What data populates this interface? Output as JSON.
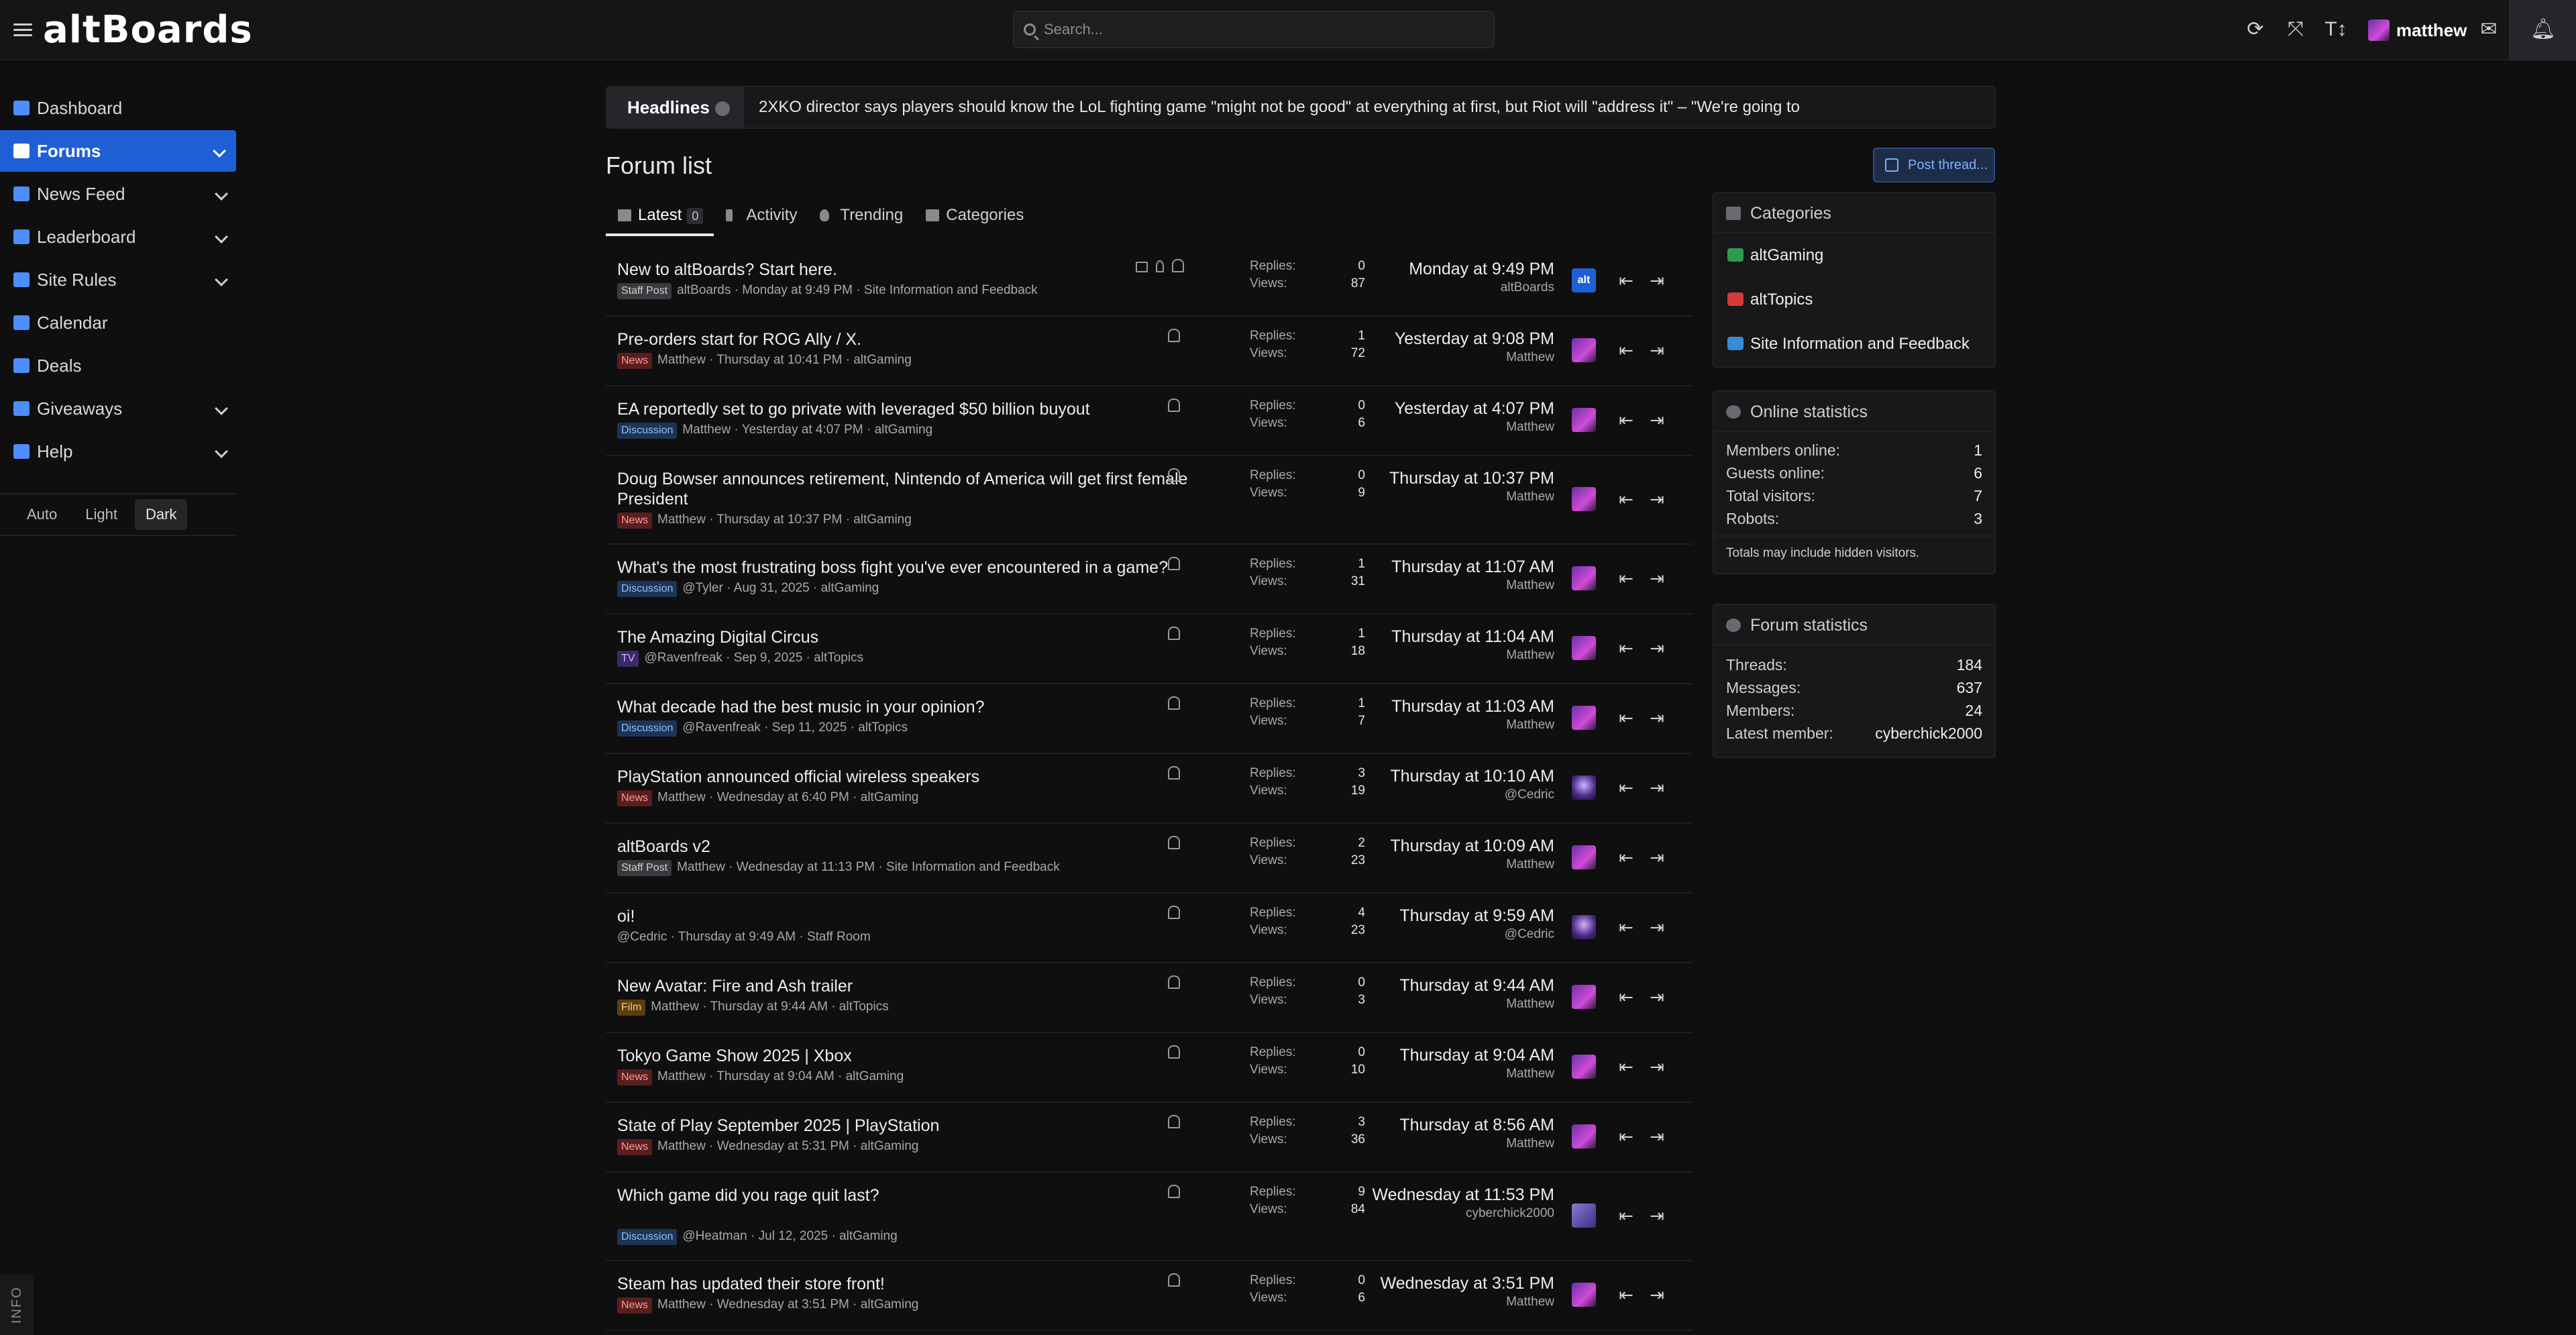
{
  "app": {
    "logo": "altBoards"
  },
  "search": {
    "placeholder": "Search..."
  },
  "user": {
    "name": "matthew"
  },
  "sidebar": {
    "items": [
      {
        "label": "Dashboard",
        "icon": "dashboard-icon",
        "color": "#4d8dff",
        "expandable": false,
        "active": false
      },
      {
        "label": "Forums",
        "icon": "forums-icon",
        "color": "#ffffff",
        "expandable": true,
        "active": true
      },
      {
        "label": "News Feed",
        "icon": "news-icon",
        "color": "#4d8dff",
        "expandable": true,
        "active": false
      },
      {
        "label": "Leaderboard",
        "icon": "trophy-icon",
        "color": "#4d8dff",
        "expandable": true,
        "active": false
      },
      {
        "label": "Site Rules",
        "icon": "gavel-icon",
        "color": "#4d8dff",
        "expandable": true,
        "active": false
      },
      {
        "label": "Calendar",
        "icon": "calendar-icon",
        "color": "#4d8dff",
        "expandable": false,
        "active": false
      },
      {
        "label": "Deals",
        "icon": "deals-icon",
        "color": "#4d8dff",
        "expandable": false,
        "active": false
      },
      {
        "label": "Giveaways",
        "icon": "gift-icon",
        "color": "#4d8dff",
        "expandable": true,
        "active": false
      },
      {
        "label": "Help",
        "icon": "help-icon",
        "color": "#4d8dff",
        "expandable": true,
        "active": false
      }
    ],
    "theme": {
      "auto": "Auto",
      "light": "Light",
      "dark": "Dark",
      "selected": "Dark"
    },
    "info_tab": "INFO"
  },
  "headlines": {
    "label": "Headlines",
    "text": "2XKO director says players should know the LoL fighting game \"might not be good\" at everything at first, but Riot will \"address it\" – \"We're going to"
  },
  "main": {
    "title": "Forum list",
    "post_button": "Post thread...",
    "tabs": [
      {
        "label": "Latest",
        "count": "0"
      },
      {
        "label": "Activity"
      },
      {
        "label": "Trending"
      },
      {
        "label": "Categories"
      }
    ],
    "replies_label": "Replies:",
    "views_label": "Views:",
    "threads": [
      {
        "title": "New to altBoards? Start here.",
        "badge": "Staff Post",
        "badge_class": "b-staff",
        "author": "altBoards",
        "date": "Monday at 9:49 PM",
        "forum": "Site Information and Feedback",
        "replies": "0",
        "views": "87",
        "last_time": "Monday at 9:49 PM",
        "last_user": "altBoards",
        "locked": true,
        "avatar": "alt",
        "avatar_text": "alt"
      },
      {
        "title": "Pre-orders start for ROG Ally / X.",
        "badge": "News",
        "badge_class": "b-news",
        "author": "Matthew",
        "date": "Thursday at 10:41 PM",
        "forum": "altGaming",
        "replies": "1",
        "views": "72",
        "last_time": "Yesterday at 9:08 PM",
        "last_user": "Matthew",
        "avatar": "mat"
      },
      {
        "title": "EA reportedly set to go private with leveraged $50 billion buyout",
        "badge": "Discussion",
        "badge_class": "b-disc",
        "author": "Matthew",
        "date": "Yesterday at 4:07 PM",
        "forum": "altGaming",
        "replies": "0",
        "views": "6",
        "last_time": "Yesterday at 4:07 PM",
        "last_user": "Matthew",
        "avatar": "mat"
      },
      {
        "title": "Doug Bowser announces retirement, Nintendo of America will get first female President",
        "badge": "News",
        "badge_class": "b-news",
        "author": "Matthew",
        "date": "Thursday at 10:37 PM",
        "forum": "altGaming",
        "replies": "0",
        "views": "9",
        "last_time": "Thursday at 10:37 PM",
        "last_user": "Matthew",
        "avatar": "mat",
        "tall": true
      },
      {
        "title": "What's the most frustrating boss fight you've ever encountered in a game?",
        "badge": "Discussion",
        "badge_class": "b-disc",
        "author": "@Tyler",
        "date": "Aug 31, 2025",
        "forum": "altGaming",
        "replies": "1",
        "views": "31",
        "last_time": "Thursday at 11:07 AM",
        "last_user": "Matthew",
        "avatar": "mat"
      },
      {
        "title": "The Amazing Digital Circus",
        "badge": "TV",
        "badge_class": "b-tv",
        "author": "@Ravenfreak",
        "date": "Sep 9, 2025",
        "forum": "altTopics",
        "replies": "1",
        "views": "18",
        "last_time": "Thursday at 11:04 AM",
        "last_user": "Matthew",
        "avatar": "mat"
      },
      {
        "title": "What decade had the best music in your opinion?",
        "badge": "Discussion",
        "badge_class": "b-disc",
        "author": "@Ravenfreak",
        "date": "Sep 11, 2025",
        "forum": "altTopics",
        "replies": "1",
        "views": "7",
        "last_time": "Thursday at 11:03 AM",
        "last_user": "Matthew",
        "avatar": "mat"
      },
      {
        "title": "PlayStation announced official wireless speakers",
        "badge": "News",
        "badge_class": "b-news",
        "author": "Matthew",
        "date": "Wednesday at 6:40 PM",
        "forum": "altGaming",
        "replies": "3",
        "views": "19",
        "last_time": "Thursday at 10:10 AM",
        "last_user": "@Cedric",
        "avatar": "ced"
      },
      {
        "title": "altBoards v2",
        "badge": "Staff Post",
        "badge_class": "b-staff",
        "author": "Matthew",
        "date": "Wednesday at 11:13 PM",
        "forum": "Site Information and Feedback",
        "replies": "2",
        "views": "23",
        "last_time": "Thursday at 10:09 AM",
        "last_user": "Matthew",
        "avatar": "mat"
      },
      {
        "title": "oi!",
        "badge": "",
        "badge_class": "",
        "author": "@Cedric",
        "date": "Thursday at 9:49 AM",
        "forum": "Staff Room",
        "replies": "4",
        "views": "23",
        "last_time": "Thursday at 9:59 AM",
        "last_user": "@Cedric",
        "avatar": "ced"
      },
      {
        "title": "New Avatar: Fire and Ash trailer",
        "badge": "Film",
        "badge_class": "b-film",
        "author": "Matthew",
        "date": "Thursday at 9:44 AM",
        "forum": "altTopics",
        "replies": "0",
        "views": "3",
        "last_time": "Thursday at 9:44 AM",
        "last_user": "Matthew",
        "avatar": "mat"
      },
      {
        "title": "Tokyo Game Show 2025 | Xbox",
        "badge": "News",
        "badge_class": "b-news",
        "author": "Matthew",
        "date": "Thursday at 9:04 AM",
        "forum": "altGaming",
        "replies": "0",
        "views": "10",
        "last_time": "Thursday at 9:04 AM",
        "last_user": "Matthew",
        "avatar": "mat"
      },
      {
        "title": "State of Play September 2025 | PlayStation",
        "badge": "News",
        "badge_class": "b-news",
        "author": "Matthew",
        "date": "Wednesday at 5:31 PM",
        "forum": "altGaming",
        "replies": "3",
        "views": "36",
        "last_time": "Thursday at 8:56 AM",
        "last_user": "Matthew",
        "avatar": "mat"
      },
      {
        "title": "Which game did you rage quit last?",
        "badge": "Discussion",
        "badge_class": "b-disc",
        "author": "@Heatman",
        "date": "Jul 12, 2025",
        "forum": "altGaming",
        "replies": "9",
        "views": "84",
        "last_time": "Wednesday at 11:53 PM",
        "last_user": "cyberchick2000",
        "avatar": "cyb",
        "tall": true
      },
      {
        "title": "Steam has updated their store front!",
        "badge": "News",
        "badge_class": "b-news",
        "author": "Matthew",
        "date": "Wednesday at 3:51 PM",
        "forum": "altGaming",
        "replies": "0",
        "views": "6",
        "last_time": "Wednesday at 3:51 PM",
        "last_user": "Matthew",
        "avatar": "mat"
      }
    ]
  },
  "right": {
    "categories": {
      "title": "Categories",
      "items": [
        {
          "label": "altGaming",
          "icon": "controller-icon",
          "color": "#2e9a4e"
        },
        {
          "label": "altTopics",
          "icon": "chat-icon",
          "color": "#d63a3a"
        },
        {
          "label": "Site Information and Feedback",
          "icon": "info-icon",
          "color": "#3a8ad6"
        }
      ]
    },
    "online": {
      "title": "Online statistics",
      "rows": [
        {
          "label": "Members online:",
          "value": "1"
        },
        {
          "label": "Guests online:",
          "value": "6"
        },
        {
          "label": "Total visitors:",
          "value": "7"
        },
        {
          "label": "Robots:",
          "value": "3"
        }
      ],
      "note": "Totals may include hidden visitors."
    },
    "forum_stats": {
      "title": "Forum statistics",
      "rows": [
        {
          "label": "Threads:",
          "value": "184"
        },
        {
          "label": "Messages:",
          "value": "637"
        },
        {
          "label": "Members:",
          "value": "24"
        },
        {
          "label": "Latest member:",
          "value": "cyberchick2000"
        }
      ]
    }
  }
}
